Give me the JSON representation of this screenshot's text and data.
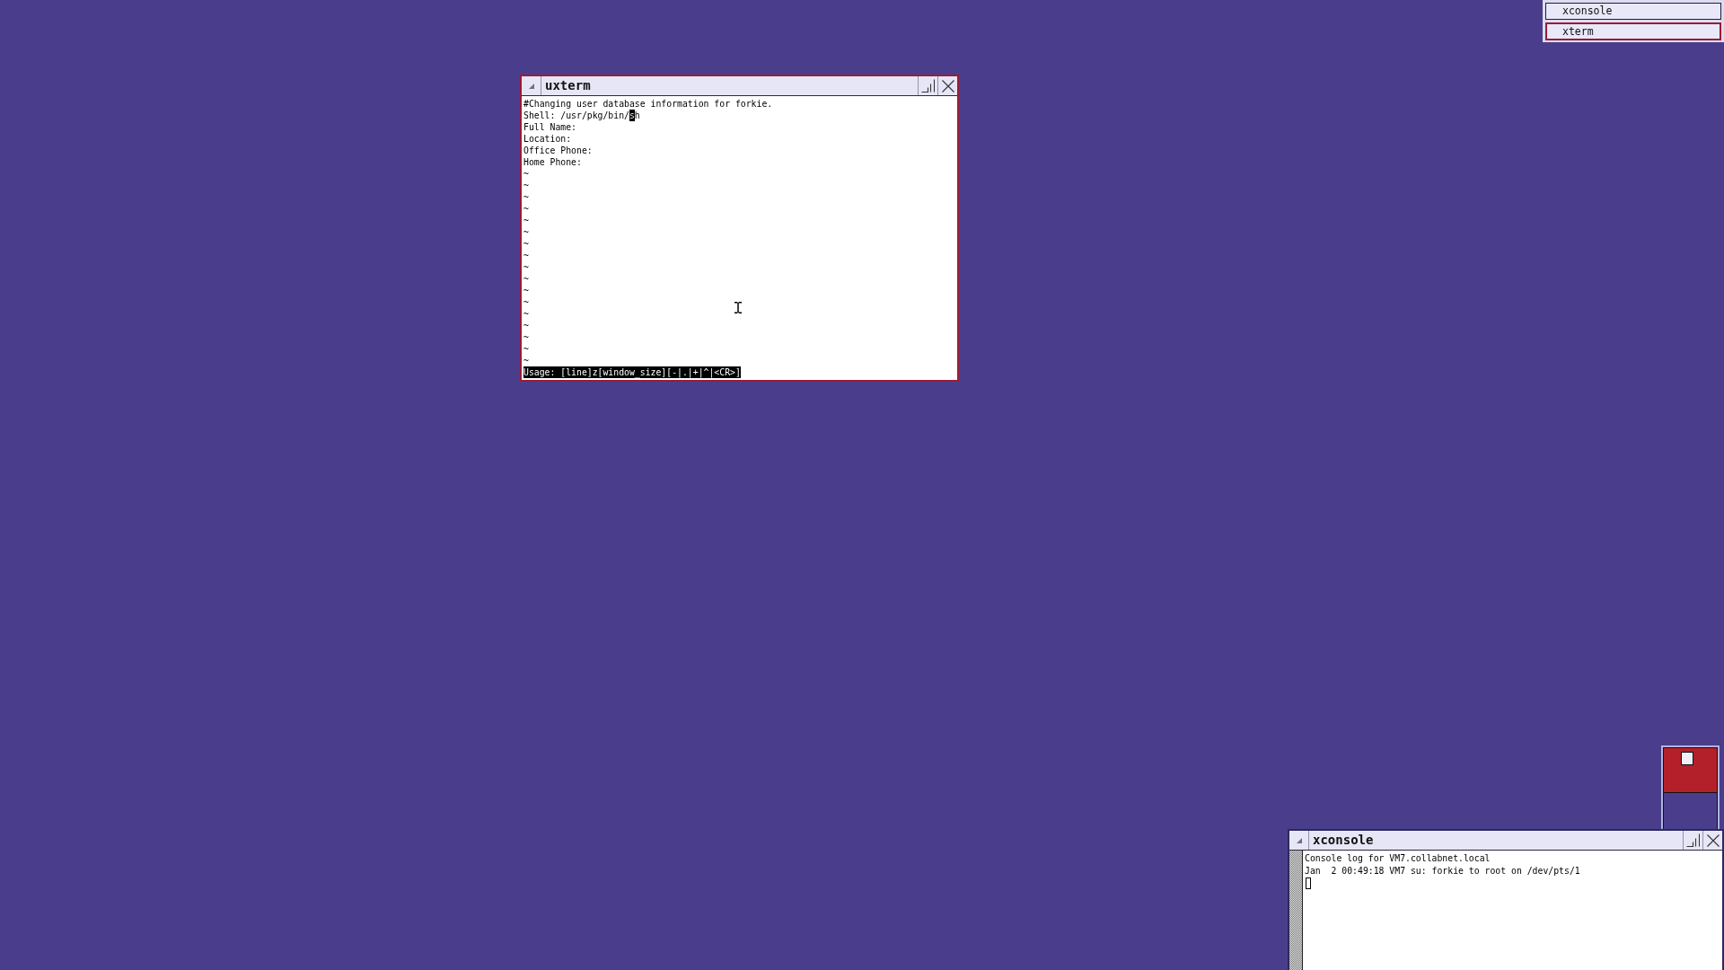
{
  "windows": [
    {
      "kind": "terminal",
      "title": "uxterm",
      "focused": true,
      "lines": [
        {
          "kind": "text",
          "text": "#Changing user database information for forkie."
        },
        {
          "kind": "edit",
          "text": "Shell: /usr/pkg/bin/",
          "cursor": "s",
          "after": "h"
        },
        {
          "kind": "text",
          "text": "Full Name:"
        },
        {
          "kind": "text",
          "text": "Location:"
        },
        {
          "kind": "text",
          "text": "Office Phone:"
        },
        {
          "kind": "text",
          "text": "Home Phone:"
        },
        {
          "kind": "text",
          "text": "~"
        },
        {
          "kind": "text",
          "text": "~"
        },
        {
          "kind": "text",
          "text": "~"
        },
        {
          "kind": "text",
          "text": "~"
        },
        {
          "kind": "text",
          "text": "~"
        },
        {
          "kind": "text",
          "text": "~"
        },
        {
          "kind": "text",
          "text": "~"
        },
        {
          "kind": "text",
          "text": "~"
        },
        {
          "kind": "text",
          "text": "~"
        },
        {
          "kind": "text",
          "text": "~"
        },
        {
          "kind": "text",
          "text": "~"
        },
        {
          "kind": "text",
          "text": "~"
        },
        {
          "kind": "text",
          "text": "~"
        },
        {
          "kind": "text",
          "text": "~"
        },
        {
          "kind": "text",
          "text": "~"
        },
        {
          "kind": "text",
          "text": "~"
        },
        {
          "kind": "text",
          "text": "~"
        }
      ],
      "status_line": "Usage: [line]z[window_size][-|.|+|^|<CR>]"
    },
    {
      "kind": "console",
      "title": "xconsole",
      "focused": false,
      "lines": [
        {
          "kind": "text",
          "text": "Console log for VM7.collabnet.local"
        },
        {
          "kind": "text",
          "text": "Jan  2 00:49:18 VM7 su: forkie to root on /dev/pts/1"
        },
        {
          "kind": "cursor"
        }
      ]
    }
  ],
  "icon_manager": {
    "entries": [
      {
        "label": "xconsole",
        "selected": false
      },
      {
        "label": "xterm",
        "selected": true
      }
    ]
  },
  "workspace_manager": {
    "workspaces": [
      {
        "selected": true,
        "has_window": true
      },
      {
        "selected": false,
        "has_window": false
      }
    ]
  }
}
